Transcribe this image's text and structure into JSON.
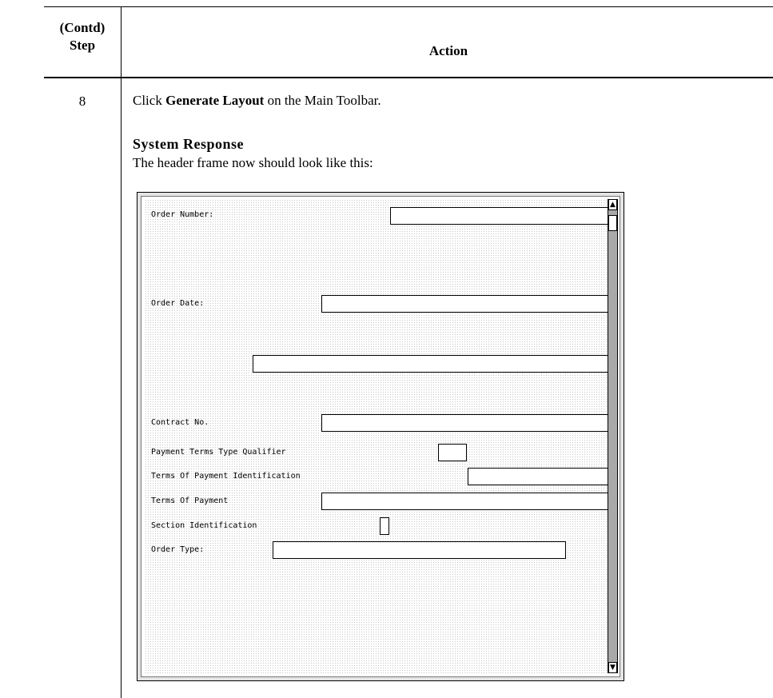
{
  "table": {
    "step_header_line1": "(Contd)",
    "step_header_line2": "Step",
    "action_header": "Action"
  },
  "row": {
    "step_number": "8",
    "instruction_prefix": "Click ",
    "instruction_bold": "Generate Layout",
    "instruction_suffix": " on the Main Toolbar.",
    "response_title": "System Response",
    "response_text": "The header frame now should look like this:"
  },
  "frame": {
    "fields": [
      {
        "label": "Order Number:"
      },
      {
        "label": "Order Date:"
      },
      {
        "label": ""
      },
      {
        "label": "Contract No."
      },
      {
        "label": "Payment Terms Type Qualifier"
      },
      {
        "label": "Terms Of Payment Identification"
      },
      {
        "label": "Terms Of Payment"
      },
      {
        "label": "Section Identification"
      },
      {
        "label": "Order Type:"
      }
    ],
    "scroll_up_icon": "▲",
    "scroll_down_icon": "▼"
  }
}
